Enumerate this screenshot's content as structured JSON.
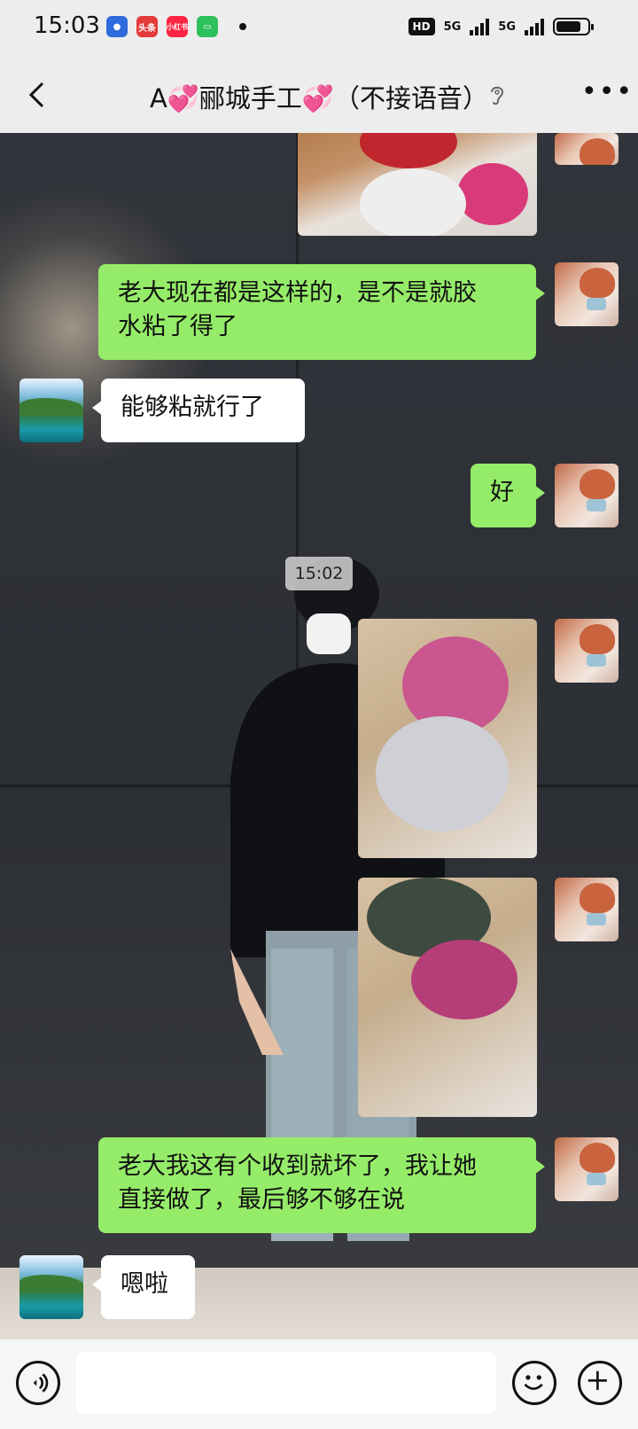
{
  "status_bar": {
    "time": "15:03",
    "apps": [
      {
        "name": "baidu-icon",
        "label": "",
        "color": "#2f6bdc"
      },
      {
        "name": "toutiao-icon",
        "label": "头条",
        "color": "#e33a3a"
      },
      {
        "name": "xiaohongshu-icon",
        "label": "小红书",
        "color": "#ff2442"
      },
      {
        "name": "wechat-icon",
        "label": "",
        "color": "#2ec05a"
      }
    ],
    "hd": "HD",
    "signal1": "5G",
    "signal2": "5G",
    "battery_level": 0.8
  },
  "header": {
    "title": "A💞郦城手工💞（不接语音）"
  },
  "chat": {
    "timestamp": "15:02",
    "messages": [
      {
        "id": "m1",
        "side": "me",
        "type": "image",
        "desc": "beads"
      },
      {
        "id": "m2",
        "side": "me",
        "type": "text",
        "text_line1": "老大现在都是这样的，是不是就胶",
        "text_line2": "水粘了得了"
      },
      {
        "id": "m3",
        "side": "them",
        "type": "text",
        "text": "能够粘就行了"
      },
      {
        "id": "m4",
        "side": "me",
        "type": "text",
        "text": "好"
      },
      {
        "id": "m5",
        "side": "me",
        "type": "image",
        "desc": "box1"
      },
      {
        "id": "m6",
        "side": "me",
        "type": "image",
        "desc": "box2"
      },
      {
        "id": "m7",
        "side": "me",
        "type": "text",
        "text_line1": "老大我这有个收到就坏了，我让她",
        "text_line2": "直接做了，最后够不够在说"
      },
      {
        "id": "m8",
        "side": "them",
        "type": "text",
        "text": "嗯啦"
      }
    ]
  },
  "input_bar": {
    "placeholder": ""
  },
  "colors": {
    "my_bubble": "#95ec69",
    "their_bubble": "#ffffff",
    "bar_background": "#ededed"
  }
}
